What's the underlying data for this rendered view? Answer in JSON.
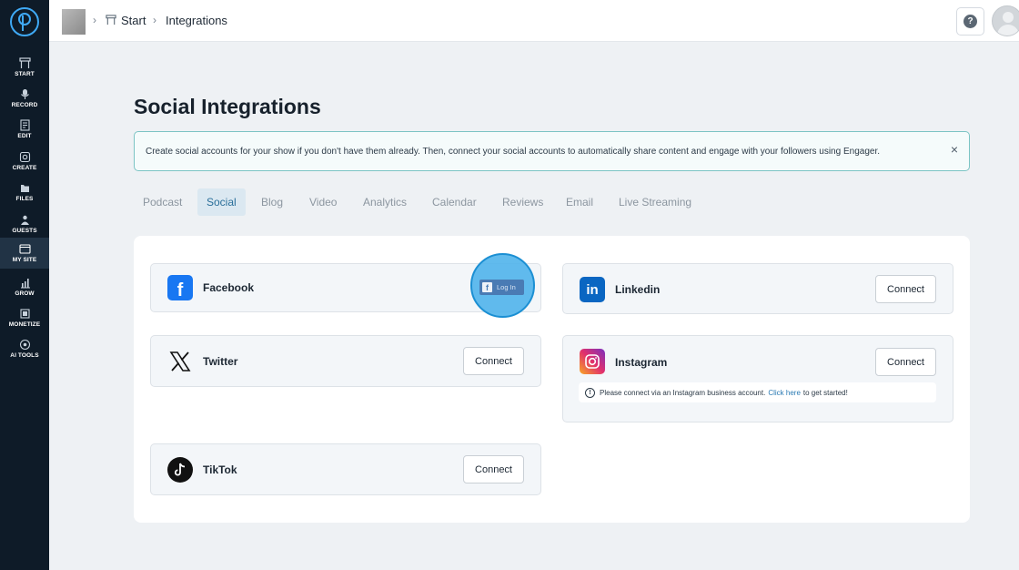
{
  "sidebar": {
    "items": [
      {
        "label": "START",
        "icon": "home-icon"
      },
      {
        "label": "RECORD",
        "icon": "microphone-icon"
      },
      {
        "label": "EDIT",
        "icon": "edit-icon"
      },
      {
        "label": "CREATE",
        "icon": "create-icon"
      },
      {
        "label": "FILES",
        "icon": "files-icon"
      },
      {
        "label": "GUESTS",
        "icon": "guests-icon"
      },
      {
        "label": "MY SITE",
        "icon": "site-icon"
      },
      {
        "label": "GROW",
        "icon": "chart-icon"
      },
      {
        "label": "MONETIZE",
        "icon": "monetize-icon"
      },
      {
        "label": "AI TOOLS",
        "icon": "ai-tools-icon"
      }
    ],
    "active": "MY SITE"
  },
  "header": {
    "breadcrumb": [
      "Start",
      "Integrations"
    ]
  },
  "main": {
    "title": "Social Integrations",
    "banner": "Create social accounts for your show if you don't have them already. Then, connect your social accounts to automatically share content and engage with your followers using Engager.",
    "banner_close": "×",
    "tabs": [
      "Podcast",
      "Social",
      "Blog",
      "Video",
      "Analytics",
      "Calendar",
      "Reviews",
      "Email",
      "Live Streaming"
    ],
    "active_tab": "Social",
    "integrations": {
      "facebook": {
        "name": "Facebook",
        "action": "Log In"
      },
      "linkedin": {
        "name": "Linkedin",
        "action": "Connect"
      },
      "twitter": {
        "name": "Twitter",
        "action": "Connect"
      },
      "instagram": {
        "name": "Instagram",
        "action": "Connect"
      },
      "tiktok": {
        "name": "TikTok",
        "action": "Connect"
      }
    },
    "instagram_note": {
      "before": "Please connect via an Instagram business account.",
      "link": "Click here",
      "after": "to get started!"
    }
  },
  "colors": {
    "sidebar_bg": "#0e1b28",
    "accent": "#2a6f9a",
    "facebook": "#1877f2",
    "linkedin": "#0a66c2",
    "highlight": "#1b8fd3"
  }
}
